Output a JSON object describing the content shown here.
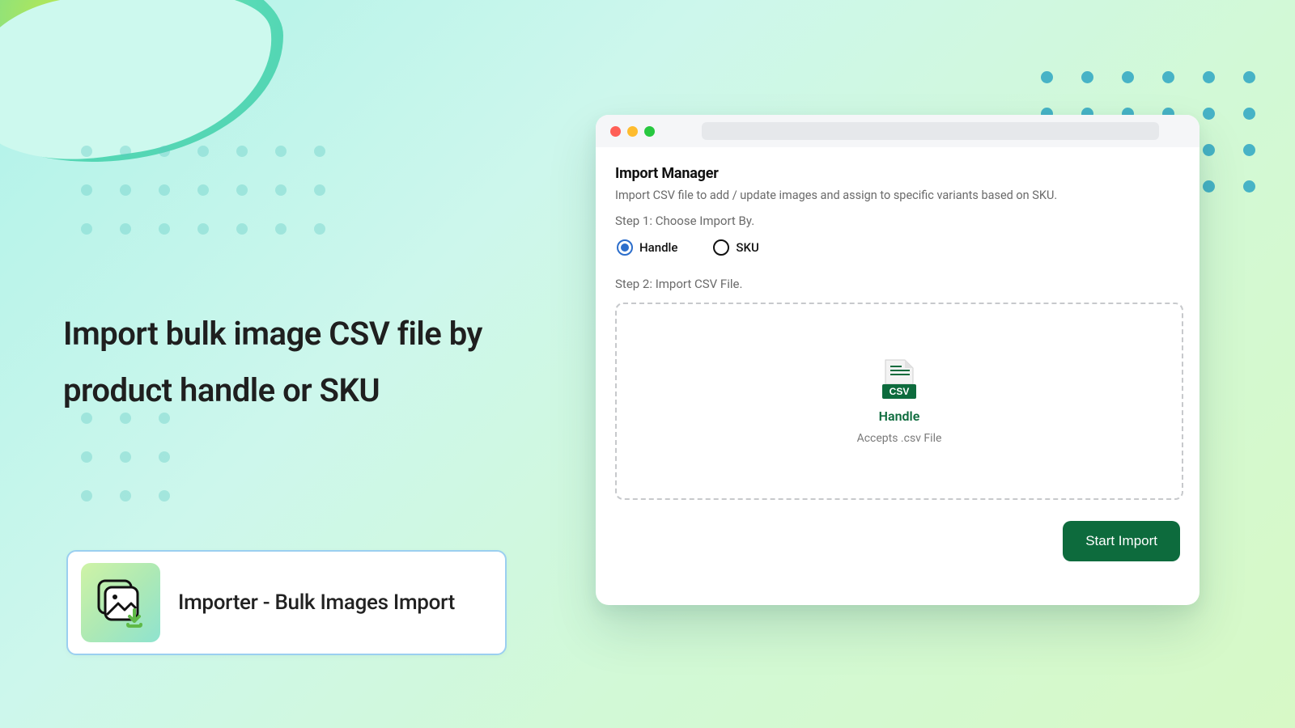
{
  "headline": "Import bulk image CSV file by product handle or SKU",
  "badge": {
    "title": "Importer - Bulk Images Import"
  },
  "window": {
    "title": "Import Manager",
    "subtitle": "Import CSV file to add / update images and assign to specific  variants based on SKU.",
    "step1": "Step 1: Choose Import By.",
    "options": {
      "handle": "Handle",
      "sku": "SKU"
    },
    "step2": "Step 2: Import CSV File.",
    "dropzone": {
      "label": "Handle",
      "accepts": "Accepts .csv File",
      "badge": "CSV"
    },
    "start_button": "Start Import"
  }
}
